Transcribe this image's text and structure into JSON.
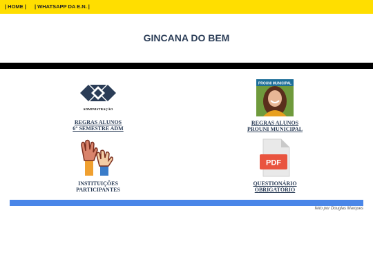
{
  "nav": {
    "home": "| HOME |",
    "whatsapp": "| WHATSAPP DA E.N. |"
  },
  "page_title": "GINCANA DO BEM",
  "tiles": [
    {
      "image_text": "ADMINISTRAÇÃO",
      "line1": "REGRAS ALUNOS",
      "line2": "6° SEMESTRE ADM",
      "icon": "administration-logo-icon"
    },
    {
      "image_text": "PROUNI MUNICIPAL",
      "line1": "REGRAS ALUNOS",
      "line2": "PROUNI MUNICIPAL",
      "icon": "prouni-photo"
    },
    {
      "line1": "INSTITUIÇÕES",
      "line2": "PARTICIPANTES",
      "icon": "raised-hands-icon"
    },
    {
      "image_text": "PDF",
      "line1": "QUESTIONÁRIO",
      "line2": "OBRIGATÓRIO",
      "icon": "pdf-file-icon"
    }
  ],
  "footer": {
    "credit": "feito por Douglas Marques"
  },
  "colors": {
    "top_bar": "#ffde00",
    "title": "#2b3d57",
    "divider": "#000000",
    "footer_bar": "#4a86e8"
  }
}
